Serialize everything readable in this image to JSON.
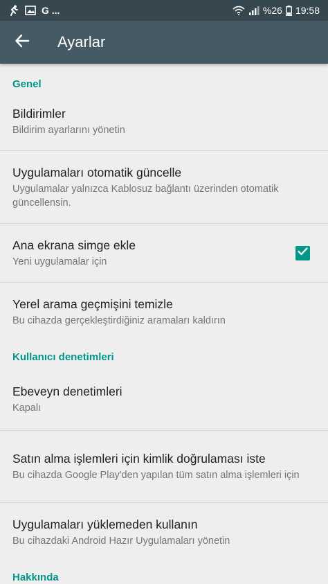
{
  "status_bar": {
    "left_text": "G ...",
    "battery": "%26",
    "time": "19:58"
  },
  "app_bar": {
    "title": "Ayarlar"
  },
  "sections": [
    {
      "header": "Genel",
      "items": [
        {
          "title": "Bildirimler",
          "summary": "Bildirim ayarlarını yönetin"
        },
        {
          "title": "Uygulamaları otomatik güncelle",
          "summary": "Uygulamalar yalnızca Kablosuz bağlantı üzerinden otomatik güncellensin."
        },
        {
          "title": "Ana ekrana simge ekle",
          "summary": "Yeni uygulamalar için",
          "checked": true
        },
        {
          "title": "Yerel arama geçmişini temizle",
          "summary": "Bu cihazda gerçekleştirdiğiniz aramaları kaldırın"
        }
      ]
    },
    {
      "header": "Kullanıcı denetimleri",
      "items": [
        {
          "title": "Ebeveyn denetimleri",
          "summary": "Kapalı"
        },
        {
          "title": "Satın alma işlemleri için kimlik doğrulaması iste",
          "summary": "Bu cihazda Google Play'den yapılan tüm satın alma işlemleri için"
        },
        {
          "title": "Uygulamaları yüklemeden kullanın",
          "summary": "Bu cihazdaki Android Hazır Uygulamaları yönetin"
        }
      ]
    },
    {
      "header": "Hakkında"
    }
  ],
  "colors": {
    "status_bar": "#37474f",
    "app_bar": "#455a64",
    "accent": "#009688",
    "background": "#eeeeee"
  }
}
